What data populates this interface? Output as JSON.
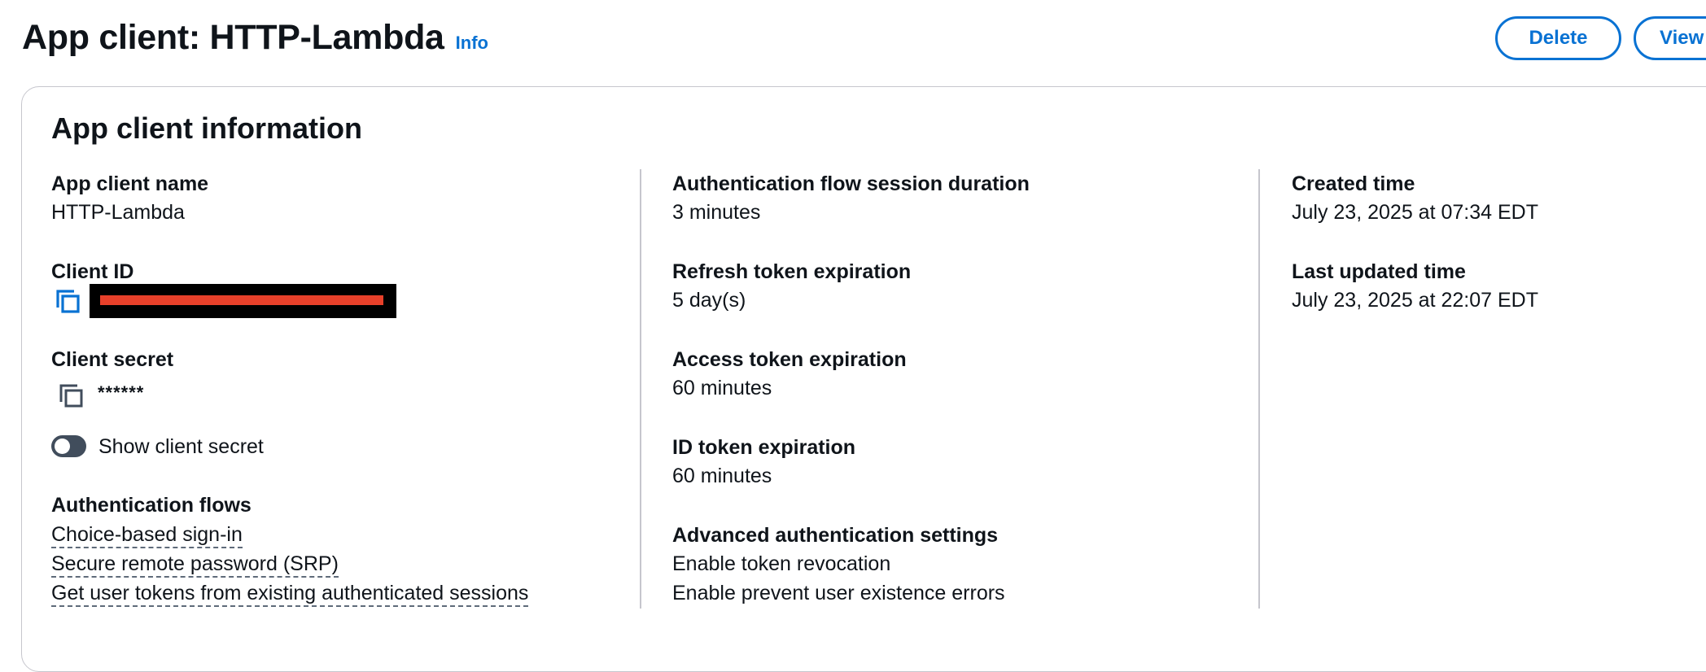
{
  "header": {
    "title": "App client: HTTP-Lambda",
    "info_label": "Info",
    "delete_label": "Delete",
    "view_label": "View"
  },
  "card": {
    "title": "App client information",
    "app_client_name": {
      "label": "App client name",
      "value": "HTTP-Lambda"
    },
    "client_id": {
      "label": "Client ID"
    },
    "client_secret": {
      "label": "Client secret",
      "value": "******"
    },
    "show_secret_label": "Show client secret",
    "auth_flows": {
      "label": "Authentication flows",
      "items": [
        "Choice-based sign-in",
        "Secure remote password (SRP)",
        "Get user tokens from existing authenticated sessions"
      ]
    },
    "session_duration": {
      "label": "Authentication flow session duration",
      "value": "3 minutes"
    },
    "refresh_token": {
      "label": "Refresh token expiration",
      "value": "5 day(s)"
    },
    "access_token": {
      "label": "Access token expiration",
      "value": "60 minutes"
    },
    "id_token": {
      "label": "ID token expiration",
      "value": "60 minutes"
    },
    "advanced": {
      "label": "Advanced authentication settings",
      "items": [
        "Enable token revocation",
        "Enable prevent user existence errors"
      ]
    },
    "created": {
      "label": "Created time",
      "value": "July 23, 2025 at 07:34 EDT"
    },
    "updated": {
      "label": "Last updated time",
      "value": "July 23, 2025 at 22:07 EDT"
    }
  },
  "colors": {
    "accent": "#0972d3",
    "text": "#0f141a",
    "toggle_off": "#414d5c",
    "redaction": "#e8402a"
  },
  "icons": [
    "copy-icon"
  ]
}
